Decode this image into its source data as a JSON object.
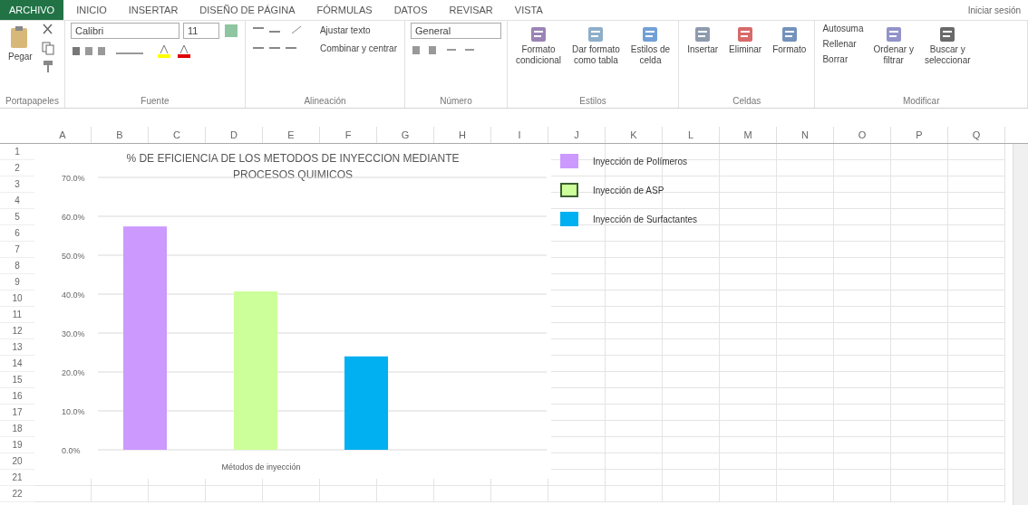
{
  "ribbon_tabs": [
    {
      "label": "ARCHIVO",
      "selected": true
    },
    {
      "label": "INICIO",
      "selected": false
    },
    {
      "label": "INSERTAR",
      "selected": false
    },
    {
      "label": "DISEÑO DE PÁGINA",
      "selected": false
    },
    {
      "label": "FÓRMULAS",
      "selected": false
    },
    {
      "label": "DATOS",
      "selected": false
    },
    {
      "label": "REVISAR",
      "selected": false
    },
    {
      "label": "VISTA",
      "selected": false
    }
  ],
  "account": "Iniciar sesión",
  "clipboard": {
    "paste": "Pegar",
    "group": "Portapapeles"
  },
  "font": {
    "name": "Calibri",
    "size": "11",
    "group": "Fuente"
  },
  "alignment": {
    "wrap": "Ajustar texto",
    "merge": "Combinar y centrar",
    "group": "Alineación"
  },
  "number": {
    "format": "General",
    "group": "Número"
  },
  "styles": {
    "buttons": [
      {
        "label": "Formato",
        "sub": "condicional"
      },
      {
        "label": "Dar formato",
        "sub": "como tabla"
      },
      {
        "label": "Estilos de",
        "sub": "celda"
      }
    ],
    "group": "Estilos"
  },
  "cells": {
    "buttons": [
      {
        "label": "Insertar"
      },
      {
        "label": "Eliminar"
      },
      {
        "label": "Formato"
      }
    ],
    "group": "Celdas"
  },
  "editing": {
    "small": [
      "Autosuma",
      "Rellenar",
      "Borrar"
    ],
    "buttons": [
      {
        "label": "Ordenar y",
        "sub": "filtrar"
      },
      {
        "label": "Buscar y",
        "sub": "seleccionar"
      }
    ],
    "group": "Modificar"
  },
  "columns": [
    "A",
    "B",
    "C",
    "D",
    "E",
    "F",
    "G",
    "H",
    "I",
    "J",
    "K",
    "L",
    "M",
    "N",
    "O",
    "P",
    "Q"
  ],
  "rows": [
    "1",
    "2",
    "3",
    "4",
    "5",
    "6",
    "7",
    "8",
    "9",
    "10",
    "11",
    "12",
    "13",
    "14",
    "15",
    "16",
    "17",
    "18",
    "19",
    "20",
    "21",
    "22"
  ],
  "chart": {
    "chart_data": {
      "type": "bar",
      "title": "% DE EFICIENCIA DE LOS METODOS DE INYECCION MEDIANTE PROCESOS QUIMICOS",
      "categories": [
        "Métodos de inyección"
      ],
      "series": [
        {
          "name": "Inyección de Polímeros",
          "color": "#cc99ff",
          "values": [
            0.574
          ]
        },
        {
          "name": "Inyección de ASP",
          "color": "#ccff99",
          "values": [
            0.407
          ]
        },
        {
          "name": "Inyección de Surfactantes",
          "color": "#00b0f0",
          "values": [
            0.24
          ]
        }
      ],
      "ylim": [
        0,
        0.7
      ],
      "grid": true,
      "yticks": [
        {
          "value": 0,
          "label": "0.0%"
        },
        {
          "value": 0.1,
          "label": "10.0%"
        },
        {
          "value": 0.2,
          "label": "20.0%"
        },
        {
          "value": 0.3,
          "label": "30.0%"
        },
        {
          "value": 0.4,
          "label": "40.0%"
        },
        {
          "value": 0.5,
          "label": "50.0%"
        },
        {
          "value": 0.6,
          "label": "60.0%"
        },
        {
          "value": 0.7,
          "label": "70.0%"
        }
      ]
    }
  }
}
